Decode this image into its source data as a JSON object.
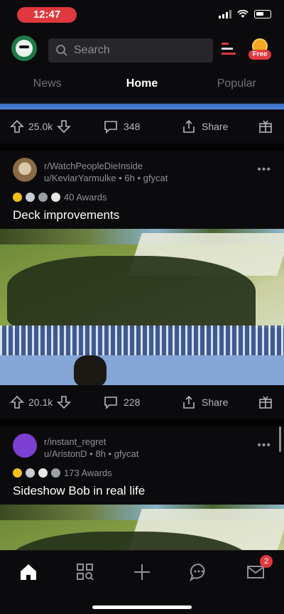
{
  "status_bar": {
    "time": "12:47"
  },
  "header": {
    "search_placeholder": "Search",
    "coins_label": "Free"
  },
  "tabs": [
    {
      "label": "News"
    },
    {
      "label": "Home"
    },
    {
      "label": "Popular"
    }
  ],
  "feed": {
    "prev_post": {
      "upvotes": "25.0k",
      "comments": "348",
      "share_label": "Share"
    },
    "posts": [
      {
        "subreddit": "r/WatchPeopleDieInside",
        "meta": "u/KevlarYarmulke • 6h • gfycat",
        "awards": "40 Awards",
        "title": "Deck improvements",
        "upvotes": "20.1k",
        "comments": "228",
        "share_label": "Share"
      },
      {
        "subreddit": "r/instant_regret",
        "meta": "u/AristonD • 8h • gfycat",
        "awards": "173 Awards",
        "title": "Sideshow Bob in real life"
      }
    ]
  },
  "bottom_nav": {
    "inbox_badge": "2"
  },
  "colors": {
    "accent": "#e0383e",
    "background": "#0b0b0d",
    "muted_text": "#8e9196"
  }
}
